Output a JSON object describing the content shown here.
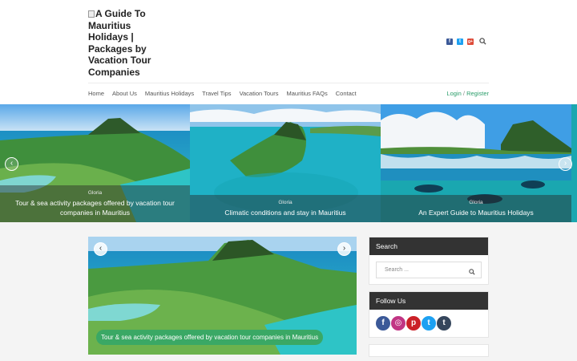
{
  "header": {
    "logo_alt": "A Guide To Mauritius Holidays | Packages by Vacation Tour Companies",
    "social": [
      {
        "icon": "facebook-icon",
        "color": "#3b5998",
        "glyph": "f"
      },
      {
        "icon": "twitter-icon",
        "color": "#1da1f2",
        "glyph": "t"
      },
      {
        "icon": "google-plus-icon",
        "color": "#dd4b39",
        "glyph": "g+"
      }
    ]
  },
  "nav": {
    "items": [
      "Home",
      "About Us",
      "Mauritius Holidays",
      "Travel Tips",
      "Vacation Tours",
      "Mauritius FAQs",
      "Contact"
    ],
    "login": "Login",
    "separator": "/",
    "register": "Register"
  },
  "slider": {
    "slides": [
      {
        "author": "Gloria",
        "title": "Tour & sea activity packages offered by vacation tour companies in Mauritius"
      },
      {
        "author": "Gloria",
        "title": "Climatic conditions and stay in Mauritius"
      },
      {
        "author": "Gloria",
        "title": "An Expert Guide to Mauritius Holidays"
      }
    ],
    "prev": "‹",
    "next": "›"
  },
  "featured": {
    "caption": "Tour & sea activity packages offered by vacation tour companies in Mauritius",
    "prev": "‹",
    "next": "›"
  },
  "sidebar": {
    "search_title": "Search",
    "search_placeholder": "Search ...",
    "follow_title": "Follow Us",
    "follow_icons": [
      {
        "icon": "facebook-icon",
        "color": "#3b5998",
        "glyph": "f"
      },
      {
        "icon": "instagram-icon",
        "color": "#c13584",
        "glyph": "◎"
      },
      {
        "icon": "pinterest-icon",
        "color": "#cb2027",
        "glyph": "p"
      },
      {
        "icon": "twitter-icon",
        "color": "#1da1f2",
        "glyph": "t"
      },
      {
        "icon": "tumblr-icon",
        "color": "#35465c",
        "glyph": "t"
      }
    ]
  },
  "colors": {
    "accent": "#2a9d6a",
    "widget_head": "#333333"
  }
}
